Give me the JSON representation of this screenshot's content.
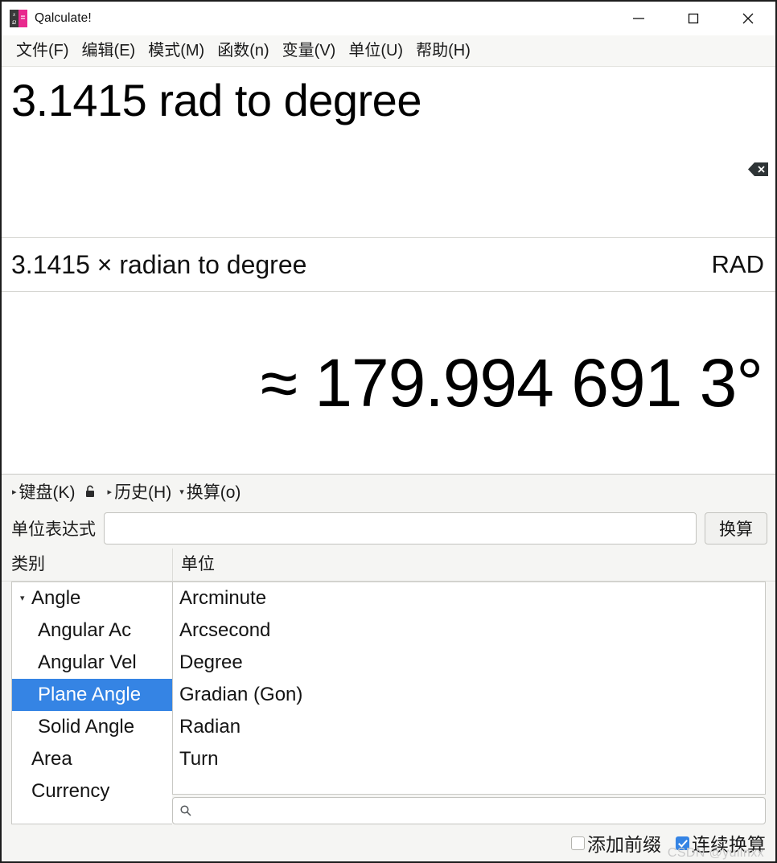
{
  "window": {
    "title": "Qalculate!",
    "icon": "calculator-icon",
    "icon_left_top": "x",
    "icon_left_bottom": "Ω",
    "icon_right": "=",
    "controls": {
      "minimize": "minimize-icon",
      "maximize": "maximize-icon",
      "close": "close-icon"
    }
  },
  "menubar": {
    "items": [
      {
        "label": "文件(F)"
      },
      {
        "label": "编辑(E)"
      },
      {
        "label": "模式(M)"
      },
      {
        "label": "函数(n)"
      },
      {
        "label": "变量(V)"
      },
      {
        "label": "单位(U)"
      },
      {
        "label": "帮助(H)"
      }
    ]
  },
  "expression": {
    "value": "3.1415 rad to degree",
    "clear_icon": "backspace-clear-icon"
  },
  "parsed": {
    "text": "3.1415 × radian to degree",
    "angle_mode": "RAD"
  },
  "result": {
    "text": "≈ 179.994 691 3°"
  },
  "expanders": [
    {
      "label": "键盘(K)",
      "arrow": "▸",
      "expanded": false,
      "lock_icon": "lock-icon"
    },
    {
      "label": "历史(H)",
      "arrow": "▸",
      "expanded": false
    },
    {
      "label": "换算(o)",
      "arrow": "▾",
      "expanded": true
    }
  ],
  "unit_expression": {
    "label": "单位表达式",
    "value": "",
    "placeholder": "",
    "button_label": "换算"
  },
  "lists": {
    "category_header": "类别",
    "unit_header": "单位",
    "categories": [
      {
        "label": "Angle",
        "level": 0,
        "expanded": true,
        "has_children": true,
        "selected": false
      },
      {
        "label": "Angular Ac",
        "level": 1,
        "selected": false
      },
      {
        "label": "Angular Vel",
        "level": 1,
        "selected": false
      },
      {
        "label": "Plane Angle",
        "level": 1,
        "selected": true
      },
      {
        "label": "Solid Angle",
        "level": 1,
        "selected": false
      },
      {
        "label": "Area",
        "level": 0,
        "selected": false
      },
      {
        "label": "Currency",
        "level": 0,
        "selected": false
      }
    ],
    "units": [
      {
        "label": "Arcminute"
      },
      {
        "label": "Arcsecond"
      },
      {
        "label": "Degree"
      },
      {
        "label": "Gradian (Gon)"
      },
      {
        "label": "Radian"
      },
      {
        "label": "Turn"
      }
    ],
    "search": {
      "value": "",
      "placeholder": "",
      "icon": "search-icon"
    }
  },
  "options": {
    "add_prefix": {
      "label": "添加前缀",
      "checked": false
    },
    "continuous_conversion": {
      "label": "连续换算",
      "checked": true
    }
  },
  "watermark": "CSDN @yulinxx",
  "colors": {
    "selection": "#3584e4",
    "accent_pink": "#e82a8e",
    "panel_bg": "#f5f5f3",
    "menubar_bg": "#f7f7f5"
  }
}
